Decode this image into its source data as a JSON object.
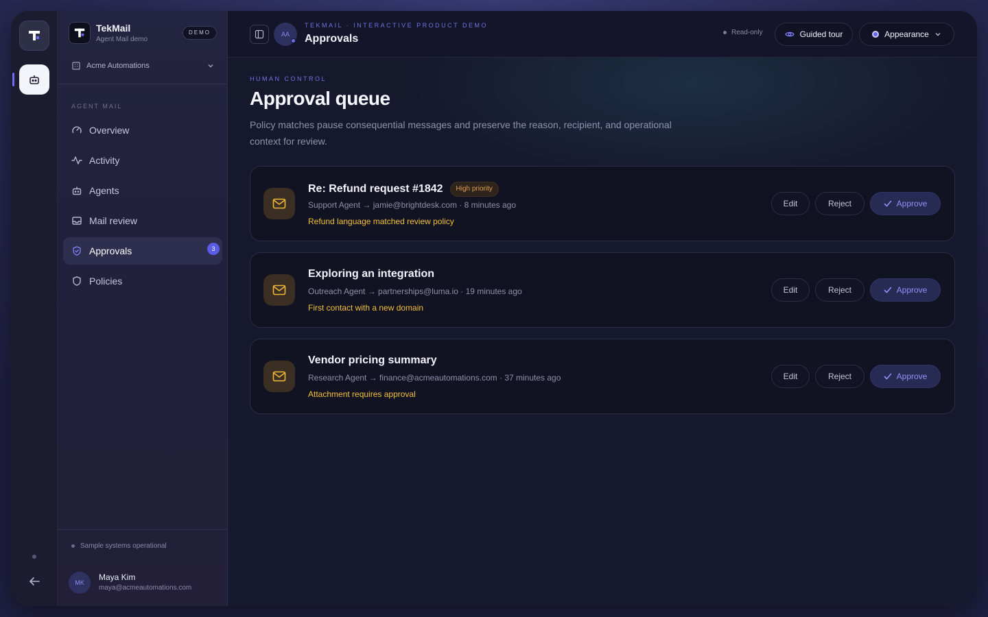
{
  "brand": {
    "name": "TekMail",
    "subtitle": "Agent Mail demo",
    "badge": "DEMO"
  },
  "workspace": {
    "name": "Acme Automations"
  },
  "sidebar": {
    "section_label": "AGENT MAIL",
    "items": [
      {
        "label": "Overview",
        "icon": "gauge-icon"
      },
      {
        "label": "Activity",
        "icon": "activity-icon"
      },
      {
        "label": "Agents",
        "icon": "bot-icon"
      },
      {
        "label": "Mail review",
        "icon": "inbox-icon"
      },
      {
        "label": "Approvals",
        "icon": "shield-check-icon",
        "active": true,
        "count": "3"
      },
      {
        "label": "Policies",
        "icon": "shield-icon"
      }
    ],
    "status": "Sample systems operational",
    "user": {
      "initials": "MK",
      "name": "Maya Kim",
      "email": "maya@acmeautomations.com"
    }
  },
  "topbar": {
    "avatar_initials": "AA",
    "eyebrow": "TEKMAIL · INTERACTIVE PRODUCT DEMO",
    "page": "Approvals",
    "readonly": "Read-only",
    "tour": "Guided tour",
    "appearance": "Appearance"
  },
  "main": {
    "section_label": "HUMAN CONTROL",
    "title": "Approval queue",
    "description": "Policy matches pause consequential messages and preserve the reason, recipient, and operational context for review.",
    "actions": {
      "edit": "Edit",
      "reject": "Reject",
      "approve": "Approve"
    },
    "approvals": [
      {
        "subject": "Re: Refund request #1842",
        "priority": "High priority",
        "meta": "Support Agent → jamie@brightdesk.com · 8 minutes ago",
        "reason": "Refund language matched review policy"
      },
      {
        "subject": "Exploring an integration",
        "meta": "Outreach Agent → partnerships@luma.io · 19 minutes ago",
        "reason": "First contact with a new domain"
      },
      {
        "subject": "Vendor pricing summary",
        "meta": "Research Agent → finance@acmeautomations.com · 37 minutes ago",
        "reason": "Attachment requires approval"
      }
    ]
  },
  "colors": {
    "accent": "#6d6ef5",
    "warning": "#f3c13a",
    "priority": "#e0a050",
    "background": "#16182c"
  }
}
